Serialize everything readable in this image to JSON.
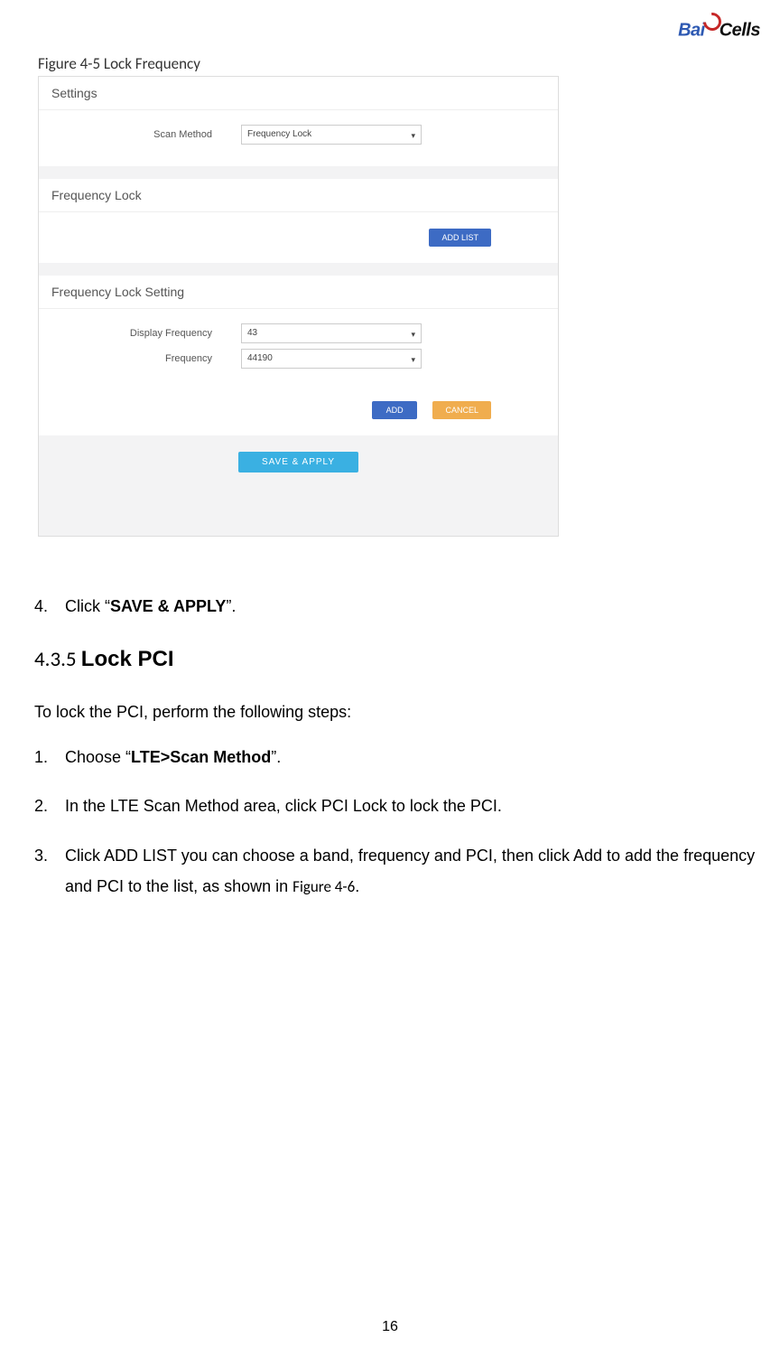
{
  "logo": {
    "part1": "Bai",
    "part2": "Cells"
  },
  "figure_label": "Figure 4-5 Lock Frequency",
  "screenshot": {
    "settings": {
      "title": "Settings",
      "scan_method_label": "Scan Method",
      "scan_method_value": "Frequency Lock"
    },
    "freq_lock": {
      "title": "Frequency Lock",
      "add_list_btn": "ADD LIST"
    },
    "freq_lock_setting": {
      "title": "Frequency Lock Setting",
      "display_freq_label": "Display Frequency",
      "display_freq_value": "43",
      "freq_label": "Frequency",
      "freq_value": "44190",
      "add_btn": "ADD",
      "cancel_btn": "CANCEL"
    },
    "save_apply_btn": "SAVE & APPLY"
  },
  "step4": {
    "num": "4.",
    "pre": "Click “",
    "bold": "SAVE & APPLY",
    "post": "”."
  },
  "section": {
    "num": "4.3.5 ",
    "title": "Lock PCI"
  },
  "intro": "To lock the PCI, perform the following steps:",
  "steps": {
    "s1": {
      "num": "1.",
      "pre": "Choose “",
      "bold": "LTE>Scan Method",
      "post": "”."
    },
    "s2": {
      "num": "2.",
      "text": "In the LTE Scan Method area, click PCI Lock to lock the PCI."
    },
    "s3": {
      "num": "3.",
      "text_a": "Click ADD LIST you can choose a band, frequency and PCI, then click Add to add the frequency and PCI to the list, as shown in ",
      "fig_ref": "Figure 4-6",
      "text_b": "."
    }
  },
  "page_num": "16"
}
